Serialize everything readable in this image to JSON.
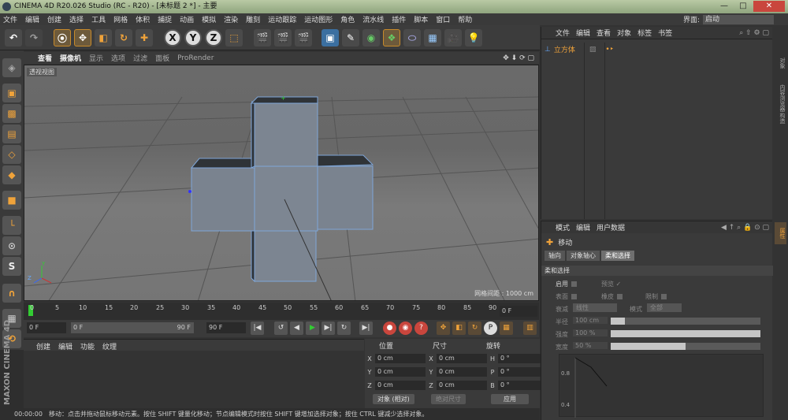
{
  "window": {
    "title": "CINEMA 4D R20.026 Studio (RC - R20) - [未标题 2 *] - 主要",
    "minimize": "—",
    "maximize": "□",
    "close": "✕"
  },
  "menubar": {
    "items": [
      "文件",
      "编辑",
      "创建",
      "选择",
      "工具",
      "网格",
      "体积",
      "捕捉",
      "动画",
      "模拟",
      "渲染",
      "雕刻",
      "运动跟踪",
      "运动图形",
      "角色",
      "流水线",
      "插件",
      "脚本",
      "窗口",
      "帮助"
    ],
    "layout_label": "界面:",
    "layout_value": "启动"
  },
  "toolbar": {
    "axis_x": "X",
    "axis_y": "Y",
    "axis_z": "Z"
  },
  "viewport": {
    "menu": [
      "查看",
      "摄像机",
      "显示",
      "选项",
      "过滤",
      "面板",
      "ProRender"
    ],
    "view_name": "透视视图",
    "grid_spacing": "网格间距 : 1000 cm",
    "axis_y_label": "Y",
    "axis_z_label": "Z"
  },
  "timeline": {
    "ticks": [
      "0",
      "5",
      "10",
      "15",
      "20",
      "25",
      "30",
      "35",
      "40",
      "45",
      "50",
      "55",
      "60",
      "65",
      "70",
      "75",
      "80",
      "85",
      "90"
    ],
    "current_frame_field": "0 F"
  },
  "transport": {
    "start_field": "0 F",
    "range_start": "0 F",
    "range_end": "90 F",
    "end_field": "90 F"
  },
  "material_panel": {
    "menu": [
      "创建",
      "编辑",
      "功能",
      "纹理"
    ]
  },
  "coordinates": {
    "headers": [
      "位置",
      "尺寸",
      "旋转"
    ],
    "rows": [
      {
        "pos_label": "X",
        "pos": "0 cm",
        "size_label": "X",
        "size": "0 cm",
        "rot_label": "H",
        "rot": "0 °"
      },
      {
        "pos_label": "Y",
        "pos": "0 cm",
        "size_label": "Y",
        "size": "0 cm",
        "rot_label": "P",
        "rot": "0 °"
      },
      {
        "pos_label": "Z",
        "pos": "0 cm",
        "size_label": "Z",
        "size": "0 cm",
        "rot_label": "B",
        "rot": "0 °"
      }
    ],
    "mode_dropdown": "对象 (相对)",
    "size_dropdown": "绝对尺寸",
    "apply_button": "应用"
  },
  "statusbar": {
    "time": "00:00:00",
    "message": "移动：点击并拖动鼠标移动元素。按住 SHIFT 键量化移动；节点编辑模式时按住 SHIFT 键增加选择对象；按住 CTRL 键减少选择对象。"
  },
  "branding": {
    "text": "MAXON CINEMA 4D"
  },
  "object_manager": {
    "menu": [
      "文件",
      "编辑",
      "查看",
      "对象",
      "标签",
      "书签"
    ],
    "object_name": "立方体"
  },
  "attribute_manager": {
    "menu": [
      "模式",
      "编辑",
      "用户数据"
    ],
    "tool_name": "移动",
    "tabs": [
      "轴向",
      "对象轴心",
      "柔和选择"
    ],
    "active_tab": "柔和选择",
    "section": "柔和选择",
    "enable_label": "启用",
    "preview_label": "预览",
    "surface_label": "表面",
    "rubber_label": "橡皮",
    "restrict_label": "限制",
    "falloff_label": "衰减",
    "falloff_value": "线性",
    "mode_label": "模式",
    "mode_value": "全部",
    "radius_label": "半径",
    "radius_value": "100 cm",
    "strength_label": "强度",
    "strength_value": "100 %",
    "width_label": "宽度",
    "width_value": "50 %",
    "width_fraction": 0.5,
    "strength_fraction": 1.0,
    "graph_labels": [
      "0.8",
      "0.4"
    ]
  },
  "side_tabs": [
    "对象",
    "内容浏览器",
    "构造",
    "属性"
  ]
}
